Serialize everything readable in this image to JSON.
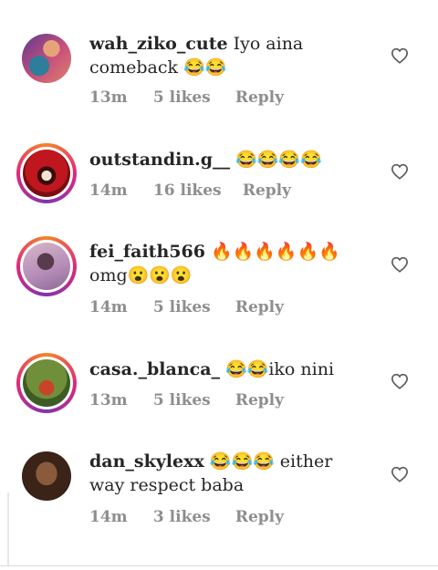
{
  "comments": [
    {
      "username": "wah_ziko_cute",
      "text": "Iyo aina comeback 😂😂",
      "time": "13m",
      "likes": "5 likes",
      "reply": "Reply",
      "avatar_colors": [
        "#5b3a8c",
        "#d9846b",
        "#2e7d9a"
      ],
      "ring": false
    },
    {
      "username": "outstandin.g__",
      "text": "😂😂😂😂",
      "time": "14m",
      "likes": "16 likes",
      "reply": "Reply",
      "avatar_colors": [
        "#c0171f",
        "#3a0b0e",
        "#f1e6d0"
      ],
      "ring": true
    },
    {
      "username": "fei_faith566",
      "text": "🔥🔥🔥🔥🔥🔥 omg😮😮😮",
      "time": "14m",
      "likes": "5 likes",
      "reply": "Reply",
      "avatar_colors": [
        "#b48bb7",
        "#5a3a4e",
        "#d6b7c8"
      ],
      "ring": true
    },
    {
      "username": "casa._blanca_",
      "text": "😂😂iko nini",
      "time": "13m",
      "likes": "5 likes",
      "reply": "Reply",
      "avatar_colors": [
        "#6f8f3a",
        "#c8432a",
        "#3d5c24"
      ],
      "ring": true
    },
    {
      "username": "dan_skylexx",
      "text": "😂😂😂 either way respect baba",
      "time": "14m",
      "likes": "3 likes",
      "reply": "Reply",
      "avatar_colors": [
        "#3b2318",
        "#8a5a3c",
        "#1b120d"
      ],
      "ring": false
    }
  ]
}
